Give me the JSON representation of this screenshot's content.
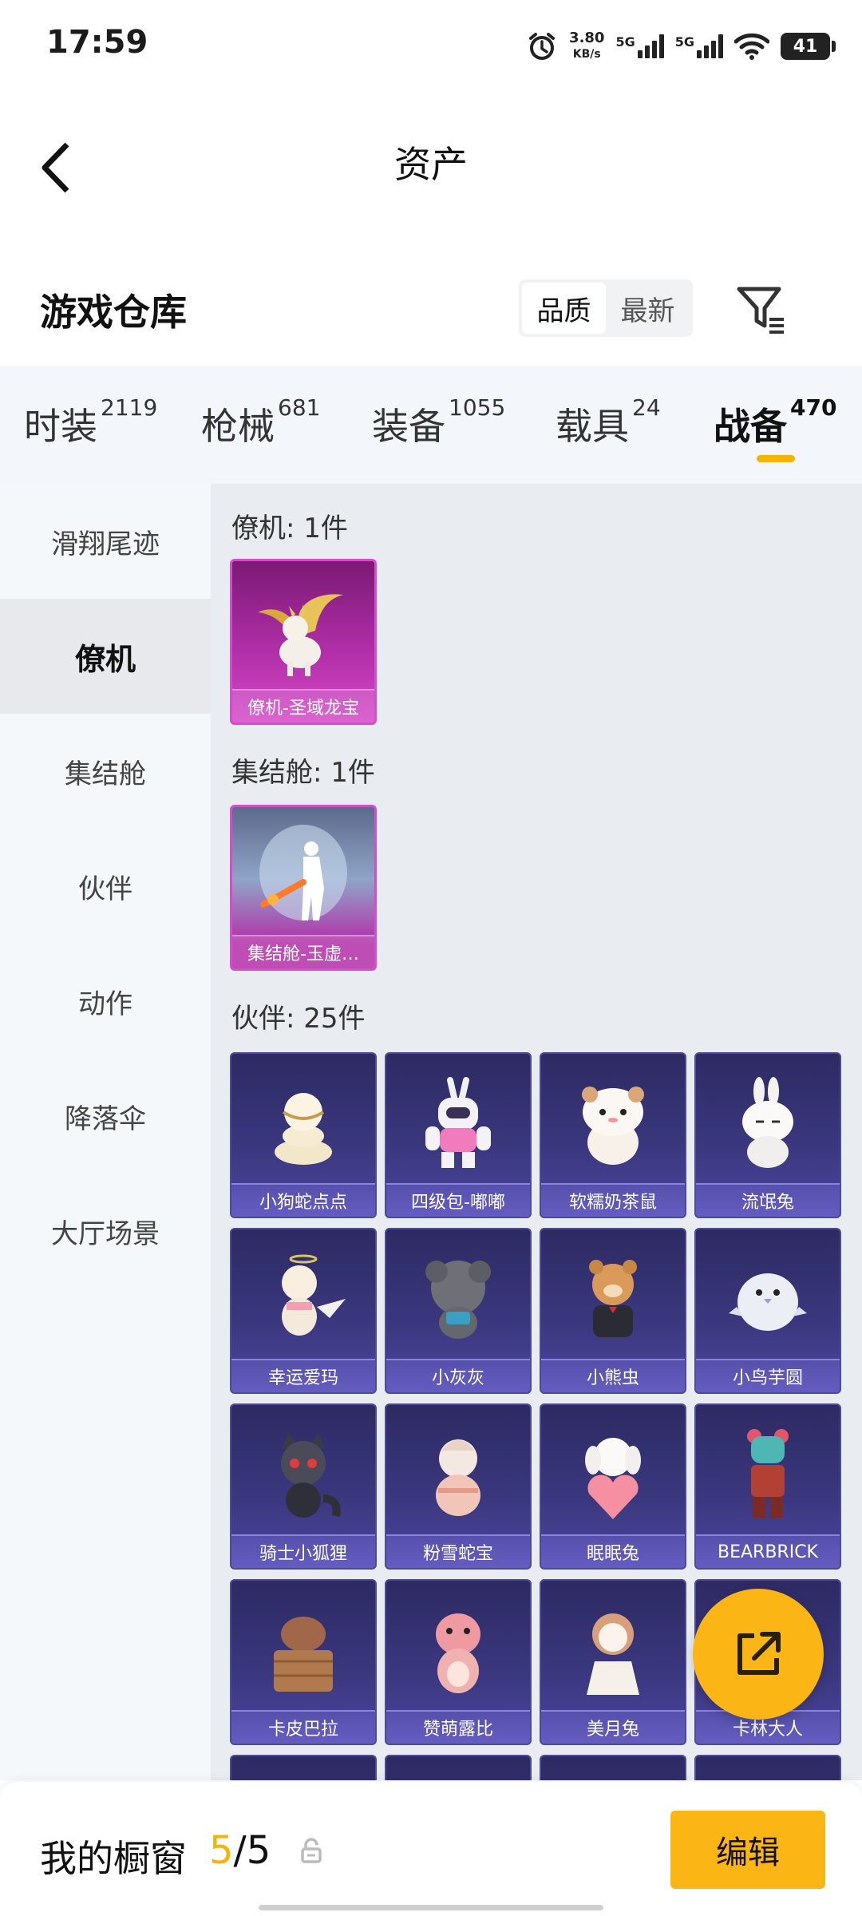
{
  "status": {
    "time": "17:59",
    "speed_value": "3.80",
    "speed_unit": "KB/s",
    "sig1": "5G",
    "sig2": "5G",
    "battery": "41"
  },
  "header": {
    "title": "资产"
  },
  "warehouse": {
    "title": "游戏仓库",
    "sort_options": [
      "品质",
      "最新"
    ]
  },
  "tabs": [
    {
      "label": "时装",
      "count": "2119"
    },
    {
      "label": "枪械",
      "count": "681"
    },
    {
      "label": "装备",
      "count": "1055"
    },
    {
      "label": "载具",
      "count": "24"
    },
    {
      "label": "战备",
      "count": "470"
    }
  ],
  "side_nav": [
    "滑翔尾迹",
    "僚机",
    "集结舱",
    "伙伴",
    "动作",
    "降落伞",
    "大厅场景"
  ],
  "sections": {
    "wingman": {
      "title": "僚机: 1件",
      "items": [
        "僚机-圣域龙宝"
      ]
    },
    "pod": {
      "title": "集结舱: 1件",
      "items": [
        "集结舱-玉虚…"
      ]
    },
    "partner": {
      "title": "伙伴: 25件",
      "items": [
        "小狗蛇点点",
        "四级包-嘟嘟",
        "软糯奶茶鼠",
        "流氓兔",
        "幸运爱玛",
        "小灰灰",
        "小熊虫",
        "小鸟芋圆",
        "骑士小狐狸",
        "粉雪蛇宝",
        "眠眠兔",
        "BEARBRICK",
        "卡皮巴拉",
        "赞萌露比",
        "美月兔",
        "卡林大人"
      ]
    }
  },
  "bottom": {
    "label": "我的橱窗",
    "current": "5",
    "slash_total": "/5",
    "edit": "编辑"
  },
  "colors": {
    "accent": "#fbb615",
    "rare_card": "#b02fa8",
    "partner_card": "#3c3880"
  }
}
